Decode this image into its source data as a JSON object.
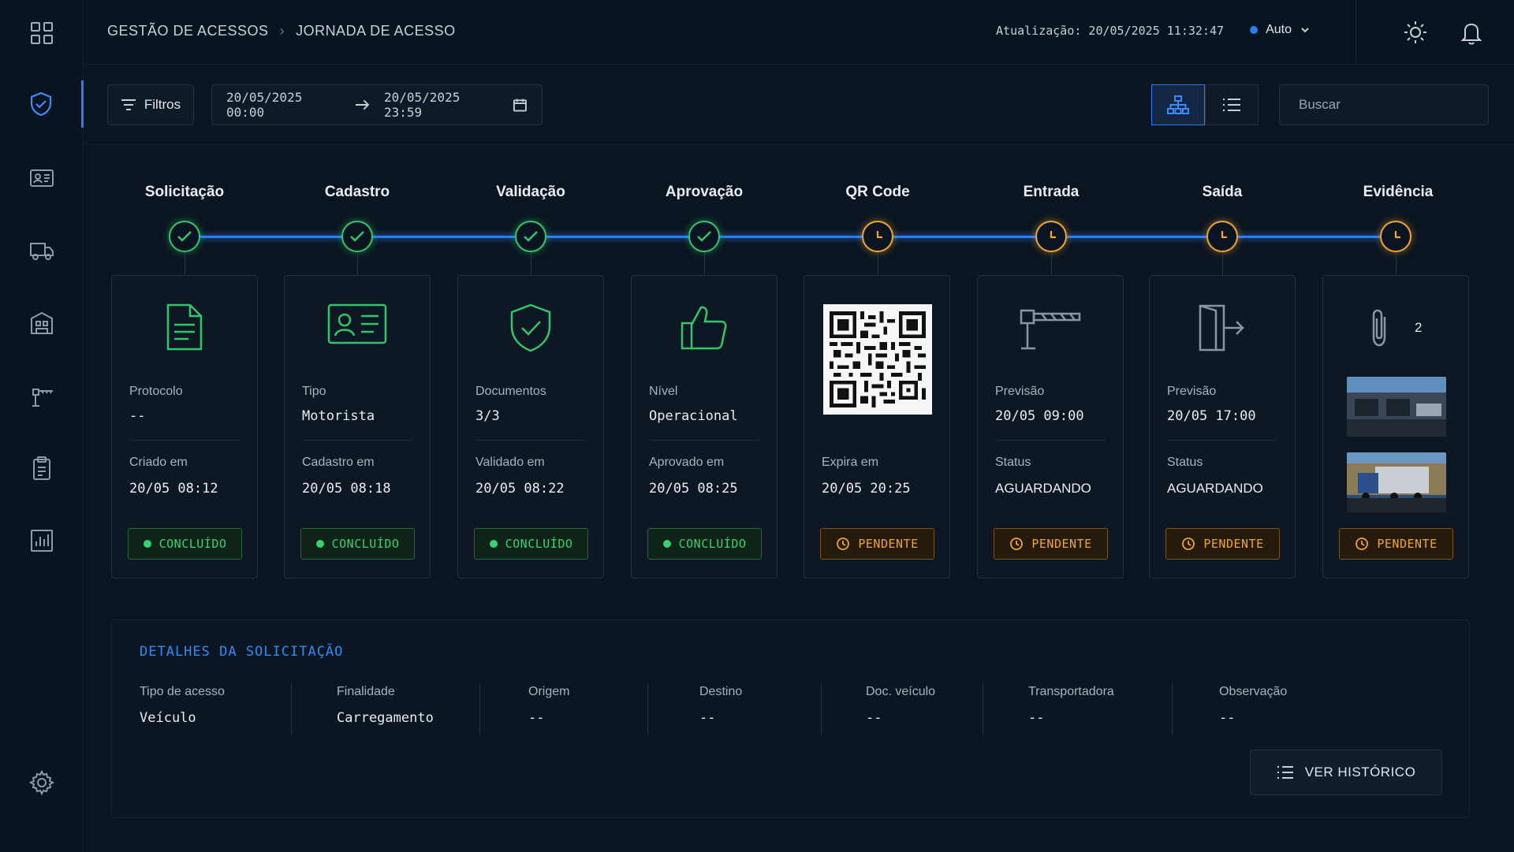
{
  "colors": {
    "accent": "#2a7cf2",
    "done": "#34c56a",
    "pending": "#f0a431"
  },
  "breadcrumb": {
    "root": "GESTÃO DE ACESSOS",
    "current": "JORNADA DE ACESSO"
  },
  "header": {
    "update_label": "Atualização: 20/05/2025 11:32:47",
    "auto_label": "Auto"
  },
  "toolbar": {
    "filters_label": "Filtros",
    "date_start": "20/05/2025 00:00",
    "date_end": "20/05/2025 23:59",
    "search_placeholder": "Buscar"
  },
  "steps": [
    {
      "title": "Solicitação",
      "status": "done",
      "icon": "document-icon",
      "label1": "Protocolo",
      "value1": "--",
      "label2": "Criado em",
      "value2": "20/05 08:12",
      "badge": "CONCLUÍDO"
    },
    {
      "title": "Cadastro",
      "status": "done",
      "icon": "id-card-icon",
      "label1": "Tipo",
      "value1": "Motorista",
      "label2": "Cadastro em",
      "value2": "20/05 08:18",
      "badge": "CONCLUÍDO"
    },
    {
      "title": "Validação",
      "status": "done",
      "icon": "shield-check-icon",
      "label1": "Documentos",
      "value1": "3/3",
      "label2": "Validado em",
      "value2": "20/05 08:22",
      "badge": "CONCLUÍDO"
    },
    {
      "title": "Aprovação",
      "status": "done",
      "icon": "thumbs-up-icon",
      "label1": "Nível",
      "value1": "Operacional",
      "label2": "Aprovado em",
      "value2": "20/05 08:25",
      "badge": "CONCLUÍDO"
    },
    {
      "title": "QR Code",
      "status": "pending",
      "icon": "qr-code-icon",
      "label2": "Expira em",
      "value2": "20/05 20:25",
      "badge": "PENDENTE"
    },
    {
      "title": "Entrada",
      "status": "pending",
      "icon": "barrier-gate-icon",
      "label1": "Previsão",
      "value1": "20/05 09:00",
      "label2": "Status",
      "value2": "AGUARDANDO",
      "badge": "PENDENTE"
    },
    {
      "title": "Saída",
      "status": "pending",
      "icon": "exit-door-icon",
      "label1": "Previsão",
      "value1": "20/05 17:00",
      "label2": "Status",
      "value2": "AGUARDANDO",
      "badge": "PENDENTE"
    },
    {
      "title": "Evidência",
      "status": "pending",
      "icon": "paperclip-icon",
      "attachments": "2",
      "badge": "PENDENTE"
    }
  ],
  "details": {
    "title": "DETALHES DA SOLICITAÇÃO",
    "fields": [
      {
        "label": "Tipo de acesso",
        "value": "Veículo"
      },
      {
        "label": "Finalidade",
        "value": "Carregamento"
      },
      {
        "label": "Origem",
        "value": "--"
      },
      {
        "label": "Destino",
        "value": "--"
      },
      {
        "label": "Doc. veículo",
        "value": "--"
      },
      {
        "label": "Transportadora",
        "value": "--"
      },
      {
        "label": "Observação",
        "value": "--"
      }
    ],
    "history_button": "VER HISTÓRICO"
  }
}
